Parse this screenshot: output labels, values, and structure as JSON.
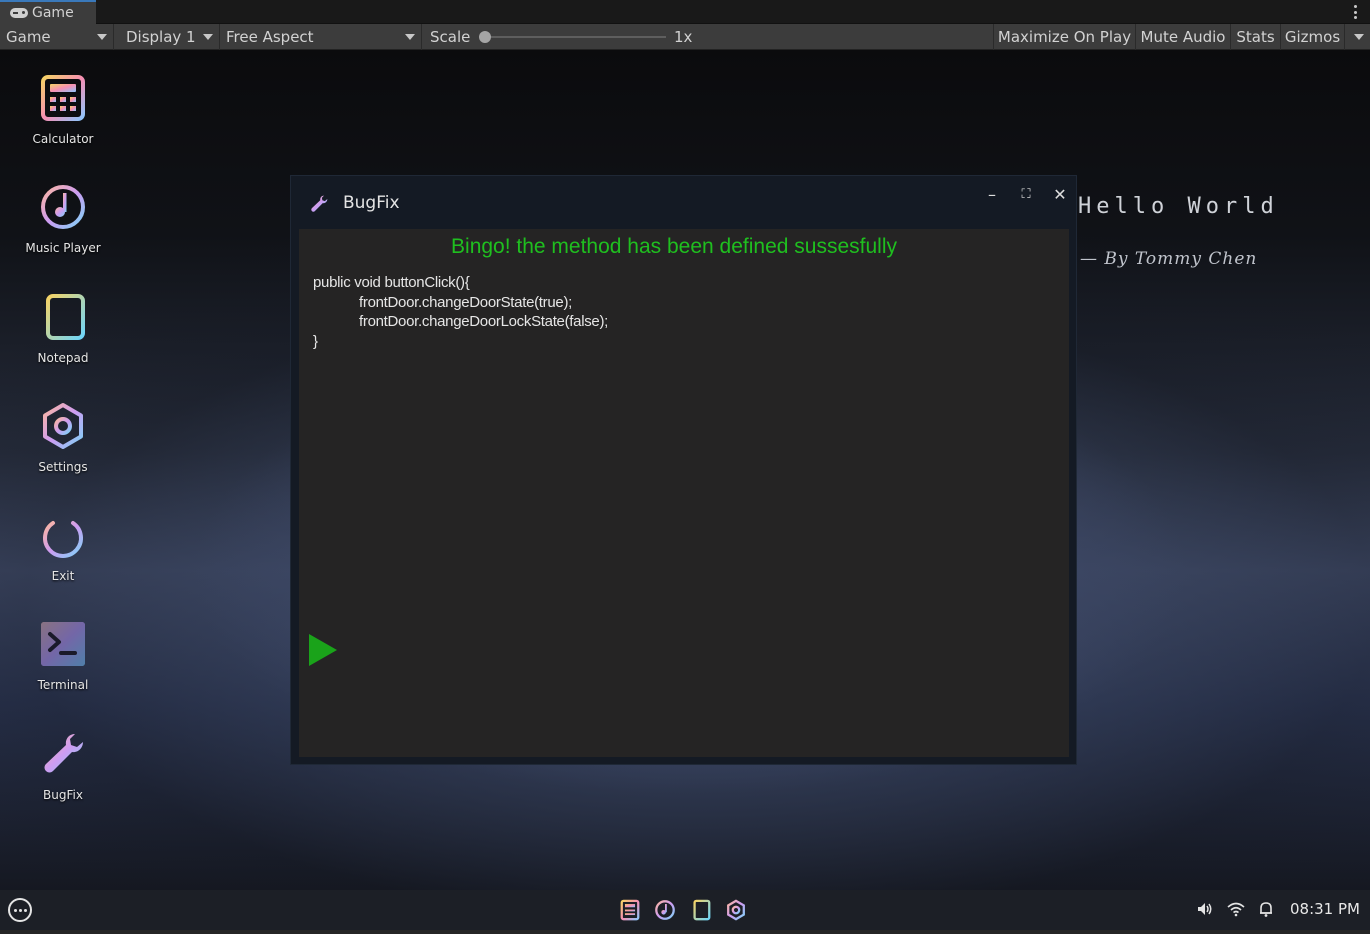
{
  "editor": {
    "tab_label": "Game",
    "toolbar": {
      "mode_dropdown": "Game",
      "display_dropdown": "Display 1",
      "aspect_dropdown": "Free Aspect",
      "scale_label": "Scale",
      "scale_value": "1x",
      "buttons": [
        "Maximize On Play",
        "Mute Audio",
        "Stats",
        "Gizmos"
      ]
    }
  },
  "desktop": {
    "heading": "Hello World",
    "byline": "— By Tommy Chen",
    "icons": [
      {
        "label": "Calculator",
        "icon": "calculator-icon"
      },
      {
        "label": "Music Player",
        "icon": "music-player-icon"
      },
      {
        "label": "Notepad",
        "icon": "notepad-icon"
      },
      {
        "label": "Settings",
        "icon": "settings-icon"
      },
      {
        "label": "Exit",
        "icon": "power-icon"
      },
      {
        "label": "Terminal",
        "icon": "terminal-icon"
      },
      {
        "label": "BugFix",
        "icon": "wrench-icon"
      }
    ]
  },
  "window": {
    "title": "BugFix",
    "message": "Bingo! the method has been defined sussesfully",
    "code": {
      "line1": "public void buttonClick(){",
      "line2": "frontDoor.changeDoorState(true);",
      "line3": "frontDoor.changeDoorLockState(false);",
      "line4": "}"
    },
    "controls": {
      "minimize": "–",
      "maximize": "⛶",
      "close": "✕"
    }
  },
  "taskbar": {
    "apps": [
      "calculator-icon",
      "music-player-icon",
      "notepad-icon",
      "settings-icon"
    ],
    "tray": [
      "volume-icon",
      "wifi-icon",
      "bell-icon"
    ],
    "clock": "08:31 PM"
  },
  "colors": {
    "success_text": "#1fbf1f",
    "run_button": "#1aa31a",
    "editor_bg": "#252424",
    "icon_gradient_start": "#f5d76e",
    "icon_gradient_end": "#7fd3f7"
  }
}
